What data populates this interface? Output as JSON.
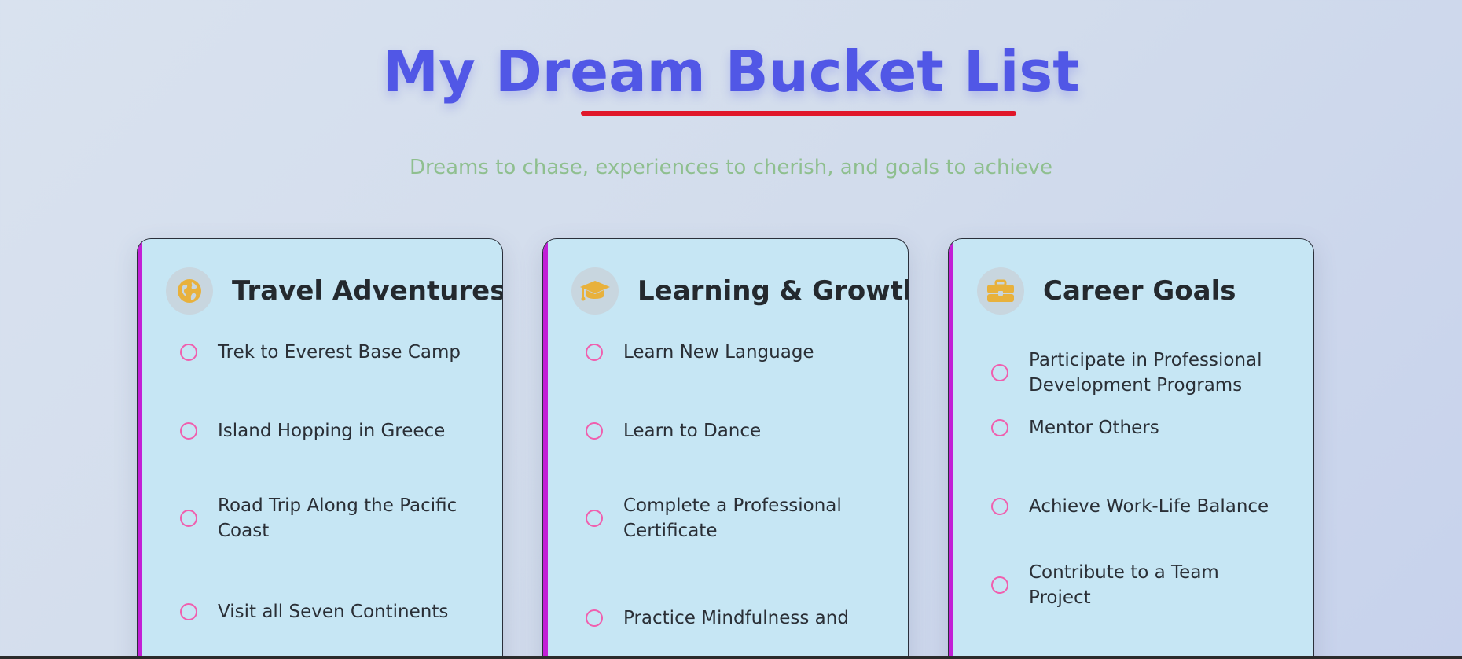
{
  "header": {
    "title": "My Dream Bucket List",
    "subtitle": "Dreams to chase, experiences to cherish, and goals to achieve"
  },
  "colors": {
    "title": "#5157e6",
    "underline": "#e0172a",
    "subtitle": "#8fbf8f",
    "card_bg": "#c6e6f4",
    "card_accent": "#c21fd6",
    "icon": "#e8b13c",
    "checkbox": "#f05fae"
  },
  "cards": [
    {
      "icon": "globe-icon",
      "title": "Travel Adventures",
      "items": [
        "Trek to Everest Base Camp",
        "Island Hopping in Greece",
        "Road Trip Along the Pacific Coast",
        "Visit all Seven Continents"
      ]
    },
    {
      "icon": "graduation-cap-icon",
      "title": "Learning & Growth",
      "items": [
        "Learn New Language",
        "Learn to Dance",
        "Complete a Professional Certificate",
        "Practice Mindfulness and"
      ]
    },
    {
      "icon": "briefcase-icon",
      "title": "Career Goals",
      "items": [
        "Participate in Professional Development Programs",
        "Mentor Others",
        "Achieve Work-Life Balance",
        "Contribute to a Team Project"
      ]
    }
  ]
}
